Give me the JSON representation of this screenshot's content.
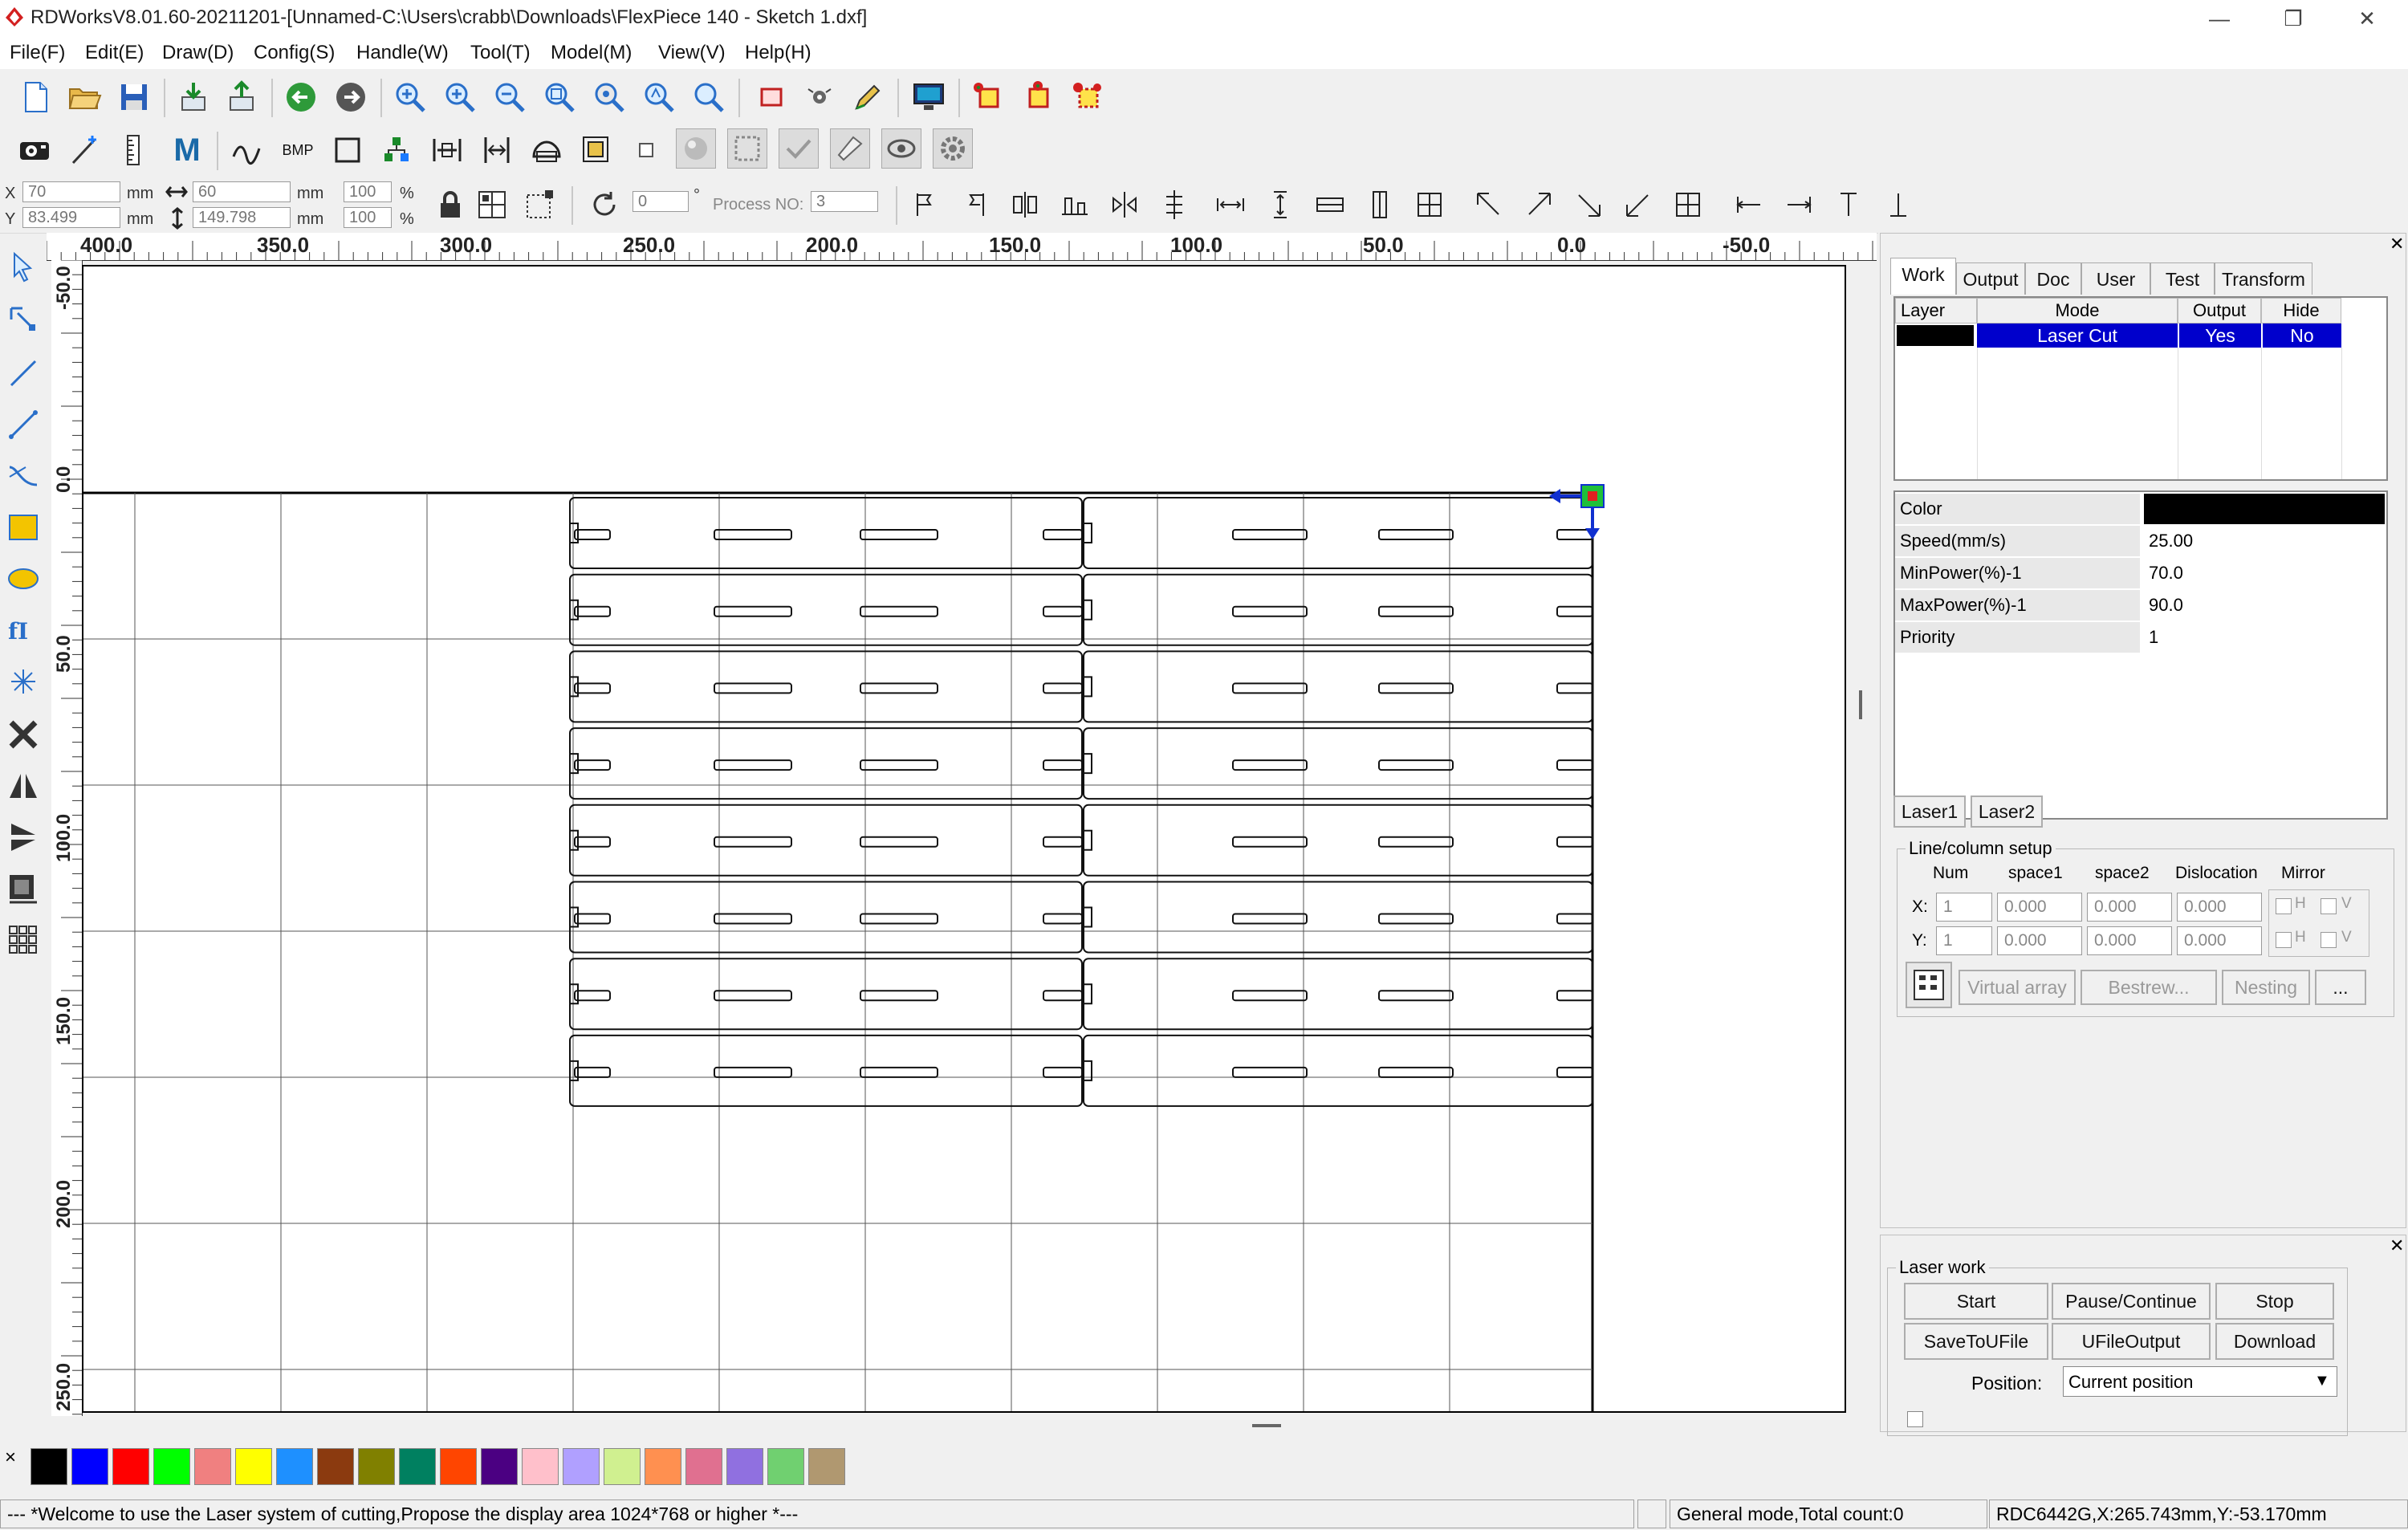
{
  "window": {
    "title": "RDWorksV8.01.60-20211201-[Unnamed-C:\\Users\\crabb\\Downloads\\FlexPiece 140 - Sketch 1.dxf]",
    "minimize": "—",
    "maximize": "❐",
    "close": "✕"
  },
  "menu": [
    "File(F)",
    "Edit(E)",
    "Draw(D)",
    "Config(S)",
    "Handle(W)",
    "Tool(T)",
    "Model(M)",
    "View(V)",
    "Help(H)"
  ],
  "toolbar": {
    "x_label": "X",
    "y_label": "Y",
    "x_value": "70",
    "y_value": "83.499",
    "unit": "mm",
    "width_value": "60",
    "height_value": "149.798",
    "scale_x": "100",
    "scale_y": "100",
    "percent": "%",
    "rotate_value": "0",
    "degree": "°",
    "process_no_label": "Process NO:",
    "process_no_value": "3",
    "bmp_label": "BMP",
    "m_label": "M"
  },
  "ruler": {
    "h_labels": [
      "400.0",
      "350.0",
      "300.0",
      "250.0",
      "200.0",
      "150.0",
      "100.0",
      "50.0",
      "0.0",
      "-50.0"
    ],
    "v_labels": [
      "-50.0",
      "0.0",
      "50.0",
      "100.0",
      "150.0",
      "200.0",
      "250.0"
    ]
  },
  "panel": {
    "tabs": [
      "Work",
      "Output",
      "Doc",
      "User",
      "Test",
      "Transform"
    ],
    "layer_headers": [
      "Layer",
      "Mode",
      "Output",
      "Hide"
    ],
    "layer_row": {
      "color": "#000000",
      "mode": "Laser Cut",
      "output": "Yes",
      "hide": "No"
    },
    "props": [
      {
        "label": "Color",
        "value": ""
      },
      {
        "label": "Speed(mm/s)",
        "value": "25.00"
      },
      {
        "label": "MinPower(%)-1",
        "value": "70.0"
      },
      {
        "label": "MaxPower(%)-1",
        "value": "90.0"
      },
      {
        "label": "Priority",
        "value": "1"
      }
    ],
    "laser_tabs": [
      "Laser1",
      "Laser2"
    ],
    "array": {
      "title": "Line/column setup",
      "headers": [
        "Num",
        "space1",
        "space2",
        "Dislocation",
        "Mirror"
      ],
      "x_label": "X:",
      "y_label": "Y:",
      "x_values": [
        "1",
        "0.000",
        "0.000",
        "0.000"
      ],
      "y_values": [
        "1",
        "0.000",
        "0.000",
        "0.000"
      ],
      "h": "H",
      "v": "V",
      "buttons": [
        "Virtual array",
        "Bestrew...",
        "Nesting",
        "..."
      ]
    },
    "laser_work": {
      "title": "Laser work",
      "buttons": [
        "Start",
        "Pause/Continue",
        "Stop",
        "SaveToUFile",
        "UFileOutput",
        "Download"
      ],
      "position_label": "Position:",
      "position_value": "Current position"
    }
  },
  "palette": [
    "#000000",
    "#0000ff",
    "#ff0000",
    "#00ff00",
    "#f08080",
    "#ffff00",
    "#1e90ff",
    "#8b3a0f",
    "#808000",
    "#008060",
    "#ff4500",
    "#4b0082",
    "#ffc0cb",
    "#b0a0ff",
    "#d0f090",
    "#ff9050",
    "#e07090",
    "#9070e0",
    "#70d070",
    "#b09870"
  ],
  "palette_close": "×",
  "status": {
    "message": "--- *Welcome to use the Laser system of cutting,Propose the display area 1024*768 or higher *---",
    "mode": "General mode,Total count:0",
    "coords": "RDC6442G,X:265.743mm,Y:-53.170mm"
  },
  "colors": {
    "layer_blue": "#0000cc",
    "accent": "#0078d7"
  }
}
